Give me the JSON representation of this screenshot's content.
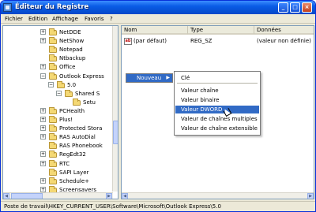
{
  "window": {
    "title": "Éditeur du Registre",
    "min_glyph": "_",
    "max_glyph": "□",
    "close_glyph": "×"
  },
  "menubar": {
    "items": [
      "Fichier",
      "Edition",
      "Affichage",
      "Favoris",
      "?"
    ]
  },
  "tree": {
    "items": [
      {
        "label": "NetDDE",
        "expander": "+"
      },
      {
        "label": "NetShow",
        "expander": "+"
      },
      {
        "label": "Notepad",
        "expander": ""
      },
      {
        "label": "Ntbackup",
        "expander": ""
      },
      {
        "label": "Office",
        "expander": "+"
      },
      {
        "label": "Outlook Express",
        "expander": "−"
      },
      {
        "label": "5.0",
        "expander": "−"
      },
      {
        "label": "Shared S",
        "expander": "−"
      },
      {
        "label": "Setu",
        "expander": ""
      },
      {
        "label": "PCHealth",
        "expander": "+"
      },
      {
        "label": "Plus!",
        "expander": "+"
      },
      {
        "label": "Protected Stora",
        "expander": "+"
      },
      {
        "label": "RAS AutoDial",
        "expander": "+"
      },
      {
        "label": "RAS Phonebook",
        "expander": ""
      },
      {
        "label": "RegEdt32",
        "expander": "+"
      },
      {
        "label": "RTC",
        "expander": "+"
      },
      {
        "label": "SAPI Layer",
        "expander": ""
      },
      {
        "label": "Schedule+",
        "expander": "+"
      },
      {
        "label": "Screensavers",
        "expander": "+"
      }
    ]
  },
  "list": {
    "columns": [
      "Nom",
      "Type",
      "Données"
    ],
    "rows": [
      {
        "icon": "ab",
        "name": "(par défaut)",
        "type": "REG_SZ",
        "data": "(valeur non définie)"
      }
    ]
  },
  "context_menu": {
    "item_label": "Nouveau",
    "arrow": "▶"
  },
  "submenu": {
    "items": [
      "Clé",
      "Valeur chaîne",
      "Valeur binaire",
      "Valeur DWORD",
      "Valeur de chaînes multiples",
      "Valeur de chaîne extensible"
    ],
    "highlighted_index": 3
  },
  "statusbar": {
    "path": "Poste de travail\\HKEY_CURRENT_USER\\Software\\Microsoft\\Outlook Express\\5.0"
  },
  "colors": {
    "titlebar": "#0a5ce6",
    "selection": "#316ac5",
    "folder": "#f4d874"
  }
}
